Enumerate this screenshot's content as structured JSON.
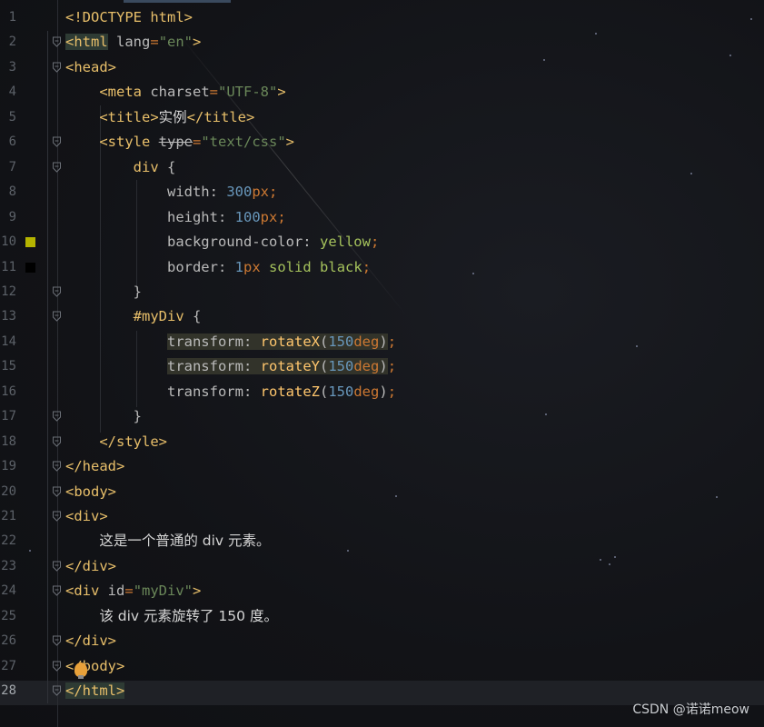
{
  "editor": {
    "lines": [
      {
        "n": "1",
        "html": "<span class='tag'>&lt;!DOCTYPE html&gt;</span>"
      },
      {
        "n": "2",
        "html": "<span class='tag hl-tag'>&lt;html</span> <span class='attr'>lang</span><span class='punct'>=</span><span class='str'>\"en\"</span><span class='tag'>&gt;</span>"
      },
      {
        "n": "3",
        "html": "<span class='tag'>&lt;head&gt;</span>"
      },
      {
        "n": "4",
        "html": "    <span class='tag'>&lt;meta</span> <span class='attr'>charset</span><span class='punct'>=</span><span class='str'>\"UTF-8\"</span><span class='tag'>&gt;</span>"
      },
      {
        "n": "5",
        "html": "    <span class='tag'>&lt;title&gt;</span><span class='txt'>实例</span><span class='tag'>&lt;/title&gt;</span>"
      },
      {
        "n": "6",
        "html": "    <span class='tag'>&lt;style</span> <span class='strike'>type</span><span class='punct'>=</span><span class='str'>\"text/css\"</span><span class='tag'>&gt;</span>"
      },
      {
        "n": "7",
        "html": "        <span class='sel'>div</span> <span class='attr'>{</span>"
      },
      {
        "n": "8",
        "html": "            <span class='prop'>width</span><span class='attr'>:</span> <span class='num'>300</span><span class='unit'>px</span><span class='punct'>;</span>"
      },
      {
        "n": "9",
        "html": "            <span class='prop'>height</span><span class='attr'>:</span> <span class='num'>100</span><span class='unit'>px</span><span class='punct'>;</span>"
      },
      {
        "n": "10",
        "html": "            <span class='prop'>background-color</span><span class='attr'>:</span> <span class='kw'>yellow</span><span class='punct'>;</span>"
      },
      {
        "n": "11",
        "html": "            <span class='prop'>border</span><span class='attr'>:</span> <span class='num'>1</span><span class='unit'>px</span> <span class='kw'>solid</span> <span class='kw'>black</span><span class='punct'>;</span>"
      },
      {
        "n": "12",
        "html": "        <span class='attr'>}</span>"
      },
      {
        "n": "13",
        "html": "        <span class='sel'>#myDiv</span> <span class='attr'>{</span>"
      },
      {
        "n": "14",
        "html": "            <span class='hl-line'><span class='prop'>transform</span><span class='attr'>:</span> <span class='fn'>rotateX</span><span class='attr'>(</span><span class='num'>150</span><span class='unit'>deg</span><span class='attr'>)</span></span><span class='punct'>;</span>"
      },
      {
        "n": "15",
        "html": "            <span class='hl-line'><span class='prop'>transform</span><span class='attr'>:</span> <span class='fn'>rotateY</span><span class='attr'>(</span><span class='num'>150</span><span class='unit'>deg</span><span class='attr'>)</span></span><span class='punct'>;</span>"
      },
      {
        "n": "16",
        "html": "            <span class='prop'>transform</span><span class='attr'>:</span> <span class='fn'>rotateZ</span><span class='attr'>(</span><span class='num'>150</span><span class='unit'>deg</span><span class='attr'>)</span><span class='punct'>;</span>"
      },
      {
        "n": "17",
        "html": "        <span class='attr'>}</span>"
      },
      {
        "n": "18",
        "html": "    <span class='tag'>&lt;/style&gt;</span>"
      },
      {
        "n": "19",
        "html": "<span class='tag'>&lt;/head&gt;</span>"
      },
      {
        "n": "20",
        "html": "<span class='tag'>&lt;body&gt;</span>"
      },
      {
        "n": "21",
        "html": "<span class='tag'>&lt;div&gt;</span>"
      },
      {
        "n": "22",
        "html": "    <span class='txt'>这是一个普通的 div 元素。</span>"
      },
      {
        "n": "23",
        "html": "<span class='tag'>&lt;/div&gt;</span>"
      },
      {
        "n": "24",
        "html": "<span class='tag'>&lt;div</span> <span class='attr'>id</span><span class='punct'>=</span><span class='str'>\"myDiv\"</span><span class='tag'>&gt;</span>"
      },
      {
        "n": "25",
        "html": "    <span class='txt'>该 div 元素旋转了 150 度。</span>"
      },
      {
        "n": "26",
        "html": "<span class='tag'>&lt;/div&gt;</span>"
      },
      {
        "n": "27",
        "html": "<span class='tag'>&lt;/body&gt;</span>"
      },
      {
        "n": "28",
        "html": "<span class='tag hl-tag'>&lt;/html&gt;</span>"
      }
    ],
    "swatches": [
      {
        "line": "10",
        "color": "#b5b400"
      },
      {
        "line": "11",
        "color": "#000000"
      }
    ],
    "current_line": "28"
  },
  "watermark": "CSDN @诺诺meow"
}
